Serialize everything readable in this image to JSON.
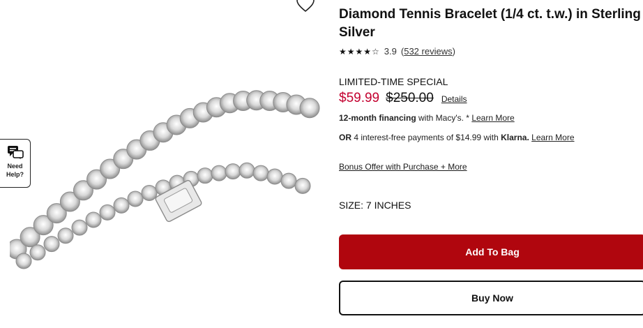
{
  "help": {
    "label": "Need\nHelp?",
    "icon": "chat-bubbles-icon"
  },
  "wishlist": {
    "icon": "heart-icon"
  },
  "product": {
    "title": "Diamond Tennis Bracelet (1/4 ct. t.w.) in Sterling Silver",
    "rating": 3.9,
    "stars": "★★★★☆",
    "rating_text": "3.9",
    "reviews_label": "532 reviews",
    "reviews_open": "(",
    "reviews_close": ")",
    "image_icon": "tennis-bracelet-image"
  },
  "pricing": {
    "special_label": "LIMITED-TIME SPECIAL",
    "sale_price": "$59.99",
    "original_price": "$250.00",
    "details_label": "Details",
    "sale_color": "#c3002f"
  },
  "financing": {
    "bold": "12-month financing",
    "text": " with Macy's. * ",
    "learn_more": "Learn More"
  },
  "klarna": {
    "or": "OR",
    "text": " 4 interest-free payments of $14.99 with ",
    "brand": "Klarna.",
    "learn_more": "Learn More"
  },
  "bonus": {
    "label": "Bonus Offer with Purchase + More"
  },
  "size": {
    "label": "SIZE: 7 INCHES"
  },
  "actions": {
    "add_to_bag": "Add To Bag",
    "buy_now": "Buy Now",
    "accent": "#b0060e"
  }
}
